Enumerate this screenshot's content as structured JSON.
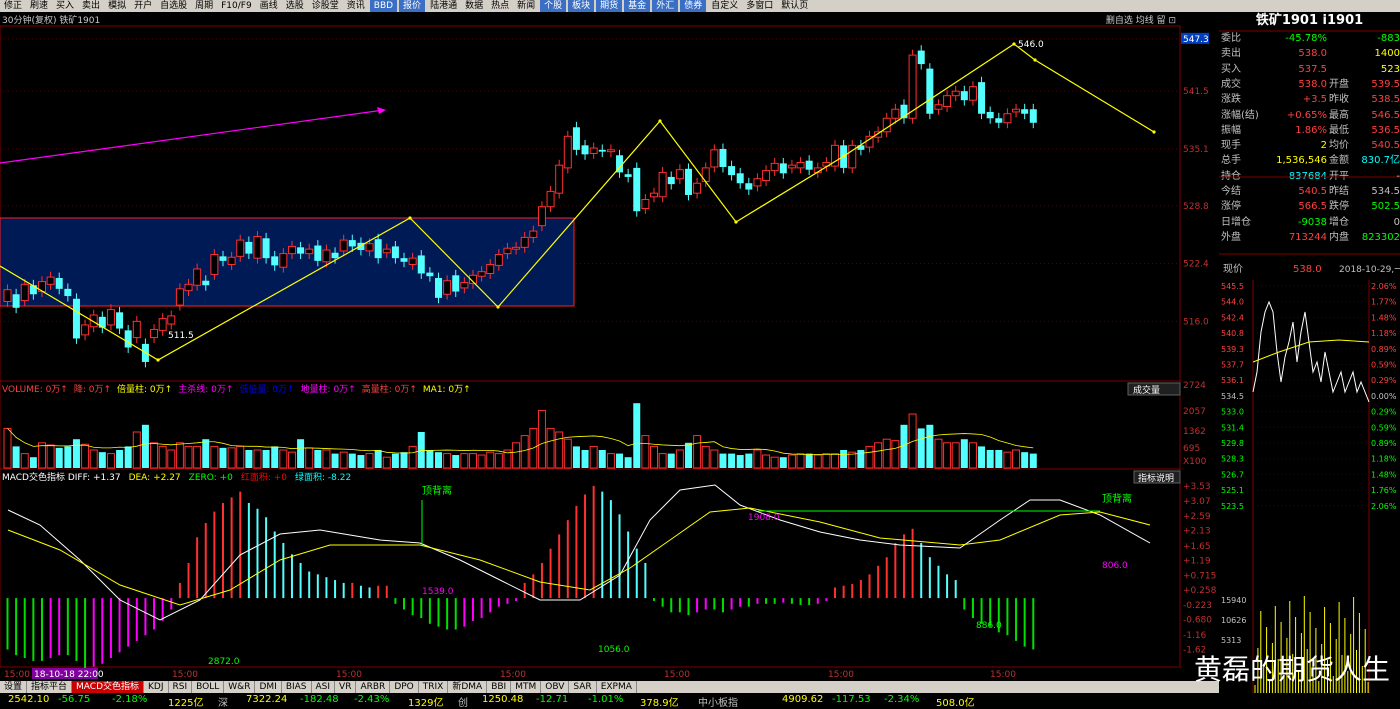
{
  "toolbar": [
    "修正",
    "刷速",
    "买入",
    "卖出",
    "模拟",
    "开户",
    "自选股",
    "周期",
    "F10/F9",
    "画线",
    "选股",
    "诊股堂",
    "资讯",
    "BBD",
    "报价",
    "陆港通",
    "数据",
    "热点",
    "新闻",
    "个股",
    "板块",
    "期货",
    "基金",
    "外汇",
    "债券",
    "自定义",
    "多窗口",
    "默认页"
  ],
  "toolbar_highlight": [
    "BBD",
    "报价",
    "个股",
    "板块",
    "期货",
    "基金",
    "外汇",
    "债券"
  ],
  "chart_title": "30分钟(复权) 铁矿1901",
  "chart_title_right": "删自选 均线 留 ⊡",
  "price_axis": [
    "547.3",
    "541.5",
    "535.1",
    "528.8",
    "522.4",
    "516.0"
  ],
  "annotations": {
    "high": "546.0",
    "low": "511.5"
  },
  "volume_legend": [
    {
      "text": "VOLUME: 0万",
      "color": "#ff4040"
    },
    {
      "text": "降: 0万",
      "color": "#ff4040"
    },
    {
      "text": "倍量柱: 0万",
      "color": "#ffff00"
    },
    {
      "text": "主杀线: 0万",
      "color": "#ff00ff"
    },
    {
      "text": "低倍量: 0万",
      "color": "#0000ff"
    },
    {
      "text": "地量柱: 0万",
      "color": "#ff00ff"
    },
    {
      "text": "高量柱: 0万",
      "color": "#ff4040"
    },
    {
      "text": "MA1: 0万",
      "color": "#ffff00"
    }
  ],
  "volume_button": "成交量",
  "volume_axis": [
    "2724",
    "2057",
    "1362",
    "695",
    "X100"
  ],
  "macd_legend": [
    {
      "text": "MACD交色指标 DIFF: +1.37",
      "color": "#ffffff"
    },
    {
      "text": "DEA: +2.27",
      "color": "#ffff00"
    },
    {
      "text": "ZERO: +0",
      "color": "#00ff00"
    },
    {
      "text": "红面积: +0",
      "color": "#ff0000"
    },
    {
      "text": "绿面积: -8.22",
      "color": "#00ffff"
    }
  ],
  "macd_button": "指标说明",
  "macd_axis": [
    "+3.53",
    "+3.07",
    "+2.59",
    "+2.13",
    "+1.65",
    "+1.19",
    "+0.715",
    "+0.258",
    "-0.223",
    "-0.680",
    "-1.16",
    "-1.62"
  ],
  "macd_labels": {
    "top_div_1": "顶背离",
    "top_div_2": "顶背离",
    "v1539": "1539.0",
    "v2872": "2872.0",
    "v1056": "1056.0",
    "v1908": "1908.0",
    "v886": "886.0",
    "v806": "806.0"
  },
  "time_axis": [
    "15:00",
    "18-10-18 22:00",
    "15:00",
    "15:00",
    "15:00",
    "15:00",
    "15:00",
    "15:00"
  ],
  "quote_panel": {
    "title": "铁矿1901 i1901",
    "rows": [
      {
        "l1": "委比",
        "v1": "-45.78%",
        "c1": "#00ff00",
        "l2": "",
        "v2": "-883",
        "c2": "#00ff00"
      },
      {
        "l1": "卖出",
        "v1": "538.0",
        "c1": "#ff4040",
        "l2": "",
        "v2": "1400",
        "c2": "#ffff00"
      },
      {
        "l1": "买入",
        "v1": "537.5",
        "c1": "#ff4040",
        "l2": "",
        "v2": "523",
        "c2": "#ffff00"
      },
      {
        "l1": "成交",
        "v1": "538.0",
        "c1": "#ff4040",
        "l2": "开盘",
        "v2": "539.5",
        "c2": "#ff4040"
      },
      {
        "l1": "涨跌",
        "v1": "+3.5",
        "c1": "#ff4040",
        "l2": "昨收",
        "v2": "538.5",
        "c2": "#ff4040"
      },
      {
        "l1": "涨幅(结)",
        "v1": "+0.65%",
        "c1": "#ff4040",
        "l2": "最高",
        "v2": "546.5",
        "c2": "#ff4040"
      },
      {
        "l1": "振幅",
        "v1": "1.86%",
        "c1": "#ff4040",
        "l2": "最低",
        "v2": "536.5",
        "c2": "#ff4040"
      },
      {
        "l1": "现手",
        "v1": "2",
        "c1": "#ffff00",
        "l2": "均价",
        "v2": "540.5",
        "c2": "#ff4040"
      },
      {
        "l1": "总手",
        "v1": "1,536,546",
        "c1": "#ffff00",
        "l2": "金额",
        "v2": "830.7亿",
        "c2": "#00ffff"
      },
      {
        "l1": "持仓",
        "v1": "837684",
        "c1": "#00ffff",
        "l2": "开平",
        "v2": "-",
        "c2": "#c0c0c0"
      },
      {
        "l1": "今结",
        "v1": "540.5",
        "c1": "#ff4040",
        "l2": "昨结",
        "v2": "534.5",
        "c2": "#c0c0c0"
      },
      {
        "l1": "涨停",
        "v1": "566.5",
        "c1": "#ff4040",
        "l2": "跌停",
        "v2": "502.5",
        "c2": "#00ff00"
      },
      {
        "l1": "日增仓",
        "v1": "-9038",
        "c1": "#00ff00",
        "l2": "增仓",
        "v2": "0",
        "c2": "#c0c0c0"
      },
      {
        "l1": "外盘",
        "v1": "713244",
        "c1": "#ff4040",
        "l2": "内盘",
        "v2": "823302",
        "c2": "#00ff00"
      }
    ],
    "current_label": "现价",
    "current_price": "538.0",
    "date": "2018-10-29,一",
    "mini_left": [
      "545.5",
      "544.0",
      "542.4",
      "540.8",
      "539.3",
      "537.7",
      "536.1",
      "534.5",
      "533.0",
      "531.4",
      "529.8",
      "528.3",
      "526.7",
      "525.1",
      "523.5",
      "15940",
      "10626",
      "5313"
    ],
    "mini_right": [
      "2.06%",
      "1.77%",
      "1.48%",
      "1.18%",
      "0.89%",
      "0.59%",
      "0.29%",
      "0.00%",
      "0.29%",
      "0.59%",
      "0.89%",
      "1.18%",
      "1.48%",
      "1.76%",
      "2.06%"
    ]
  },
  "tabs": [
    "设置",
    "指标平台",
    "MACD交色指标",
    "KDJ",
    "RSI",
    "BOLL",
    "W&R",
    "DMI",
    "BIAS",
    "ASI",
    "VR",
    "ARBR",
    "DPO",
    "TRIX",
    "新DMA",
    "BBI",
    "MTM",
    "OBV",
    "SAR",
    "EXPMA"
  ],
  "active_tab": "MACD交色指标",
  "status": [
    {
      "text": "2542.10",
      "color": "#ffff00"
    },
    {
      "text": "-56.75",
      "color": "#00ff00"
    },
    {
      "text": "-2.18%",
      "color": "#00ff00"
    },
    {
      "text": "1225亿",
      "color": "#ffff00"
    },
    {
      "text": "深",
      "color": "#c0c0c0"
    },
    {
      "text": "7322.24",
      "color": "#ffff00"
    },
    {
      "text": "-182.48",
      "color": "#00ff00"
    },
    {
      "text": "-2.43%",
      "color": "#00ff00"
    },
    {
      "text": "1329亿",
      "color": "#ffff00"
    },
    {
      "text": "创",
      "color": "#c0c0c0"
    },
    {
      "text": "1250.48",
      "color": "#ffff00"
    },
    {
      "text": "-12.71",
      "color": "#00ff00"
    },
    {
      "text": "-1.01%",
      "color": "#00ff00"
    },
    {
      "text": "378.9亿",
      "color": "#ffff00"
    },
    {
      "text": "中小板指",
      "color": "#c0c0c0"
    },
    {
      "text": "4909.62",
      "color": "#ffff00"
    },
    {
      "text": "-117.53",
      "color": "#00ff00"
    },
    {
      "text": "-2.34%",
      "color": "#00ff00"
    },
    {
      "text": "508.0亿",
      "color": "#ffff00"
    }
  ],
  "watermark": "黄磊的期货人生",
  "chart_data": {
    "type": "candlestick",
    "bars": [
      {
        "o": 518.2,
        "c": 519.5
      },
      {
        "o": 519.0,
        "c": 517.5
      },
      {
        "o": 518.3,
        "c": 520.1
      },
      {
        "o": 520.0,
        "c": 519.0
      },
      {
        "o": 519.3,
        "c": 520.4
      },
      {
        "o": 520.1,
        "c": 520.9
      },
      {
        "o": 520.8,
        "c": 519.6
      },
      {
        "o": 519.6,
        "c": 518.8
      },
      {
        "o": 518.5,
        "c": 514.1
      },
      {
        "o": 514.5,
        "c": 515.6
      },
      {
        "o": 515.4,
        "c": 516.7
      },
      {
        "o": 516.5,
        "c": 515.3
      },
      {
        "o": 515.6,
        "c": 517.3
      },
      {
        "o": 517.0,
        "c": 515.2
      },
      {
        "o": 515.0,
        "c": 513.1
      },
      {
        "o": 514.2,
        "c": 516.0
      },
      {
        "o": 513.5,
        "c": 511.5
      },
      {
        "o": 514.2,
        "c": 515.1
      },
      {
        "o": 515.0,
        "c": 516.3
      },
      {
        "o": 515.7,
        "c": 516.6
      },
      {
        "o": 517.8,
        "c": 519.6
      },
      {
        "o": 519.4,
        "c": 520.1
      },
      {
        "o": 520.0,
        "c": 521.8
      },
      {
        "o": 520.5,
        "c": 520.0
      },
      {
        "o": 521.2,
        "c": 523.4
      },
      {
        "o": 523.2,
        "c": 522.7
      },
      {
        "o": 522.3,
        "c": 523.1
      },
      {
        "o": 523.2,
        "c": 525.0
      },
      {
        "o": 524.8,
        "c": 523.5
      },
      {
        "o": 523.0,
        "c": 525.4
      },
      {
        "o": 525.2,
        "c": 523.0
      },
      {
        "o": 523.2,
        "c": 522.2
      },
      {
        "o": 522.0,
        "c": 523.5
      },
      {
        "o": 523.5,
        "c": 524.3
      },
      {
        "o": 524.2,
        "c": 523.5
      },
      {
        "o": 523.5,
        "c": 524.0
      },
      {
        "o": 524.4,
        "c": 522.7
      },
      {
        "o": 522.6,
        "c": 523.9
      },
      {
        "o": 523.6,
        "c": 523.0
      },
      {
        "o": 523.8,
        "c": 525.0
      },
      {
        "o": 525.0,
        "c": 524.3
      },
      {
        "o": 524.7,
        "c": 523.9
      },
      {
        "o": 523.8,
        "c": 524.6
      },
      {
        "o": 525.1,
        "c": 523.0
      },
      {
        "o": 523.6,
        "c": 524.0
      },
      {
        "o": 524.3,
        "c": 523.0
      },
      {
        "o": 523.0,
        "c": 522.6
      },
      {
        "o": 522.3,
        "c": 523.0
      },
      {
        "o": 523.3,
        "c": 521.3
      },
      {
        "o": 521.4,
        "c": 521.0
      },
      {
        "o": 520.8,
        "c": 518.6
      },
      {
        "o": 519.0,
        "c": 520.5
      },
      {
        "o": 521.1,
        "c": 519.3
      },
      {
        "o": 519.7,
        "c": 520.3
      },
      {
        "o": 520.2,
        "c": 521.1
      },
      {
        "o": 521.0,
        "c": 521.5
      },
      {
        "o": 521.3,
        "c": 522.3
      },
      {
        "o": 522.2,
        "c": 523.4
      },
      {
        "o": 523.5,
        "c": 524.1
      },
      {
        "o": 524.0,
        "c": 524.2
      },
      {
        "o": 524.2,
        "c": 525.3
      },
      {
        "o": 525.3,
        "c": 526.0
      },
      {
        "o": 526.6,
        "c": 528.7
      },
      {
        "o": 528.7,
        "c": 530.4
      },
      {
        "o": 530.2,
        "c": 533.3
      },
      {
        "o": 533.0,
        "c": 536.5
      },
      {
        "o": 537.5,
        "c": 535.0
      },
      {
        "o": 535.5,
        "c": 534.5
      },
      {
        "o": 534.6,
        "c": 535.2
      },
      {
        "o": 535.0,
        "c": 534.8
      },
      {
        "o": 534.8,
        "c": 535.0
      },
      {
        "o": 534.4,
        "c": 532.5
      },
      {
        "o": 532.3,
        "c": 532.0
      },
      {
        "o": 533.0,
        "c": 528.2
      },
      {
        "o": 528.5,
        "c": 529.5
      },
      {
        "o": 529.8,
        "c": 530.2
      },
      {
        "o": 529.8,
        "c": 532.5
      },
      {
        "o": 532.0,
        "c": 531.2
      },
      {
        "o": 531.8,
        "c": 532.8
      },
      {
        "o": 532.9,
        "c": 530.0
      },
      {
        "o": 530.2,
        "c": 531.3
      },
      {
        "o": 531.5,
        "c": 533.0
      },
      {
        "o": 533.1,
        "c": 535.0
      },
      {
        "o": 535.1,
        "c": 533.1
      },
      {
        "o": 533.2,
        "c": 532.2
      },
      {
        "o": 532.4,
        "c": 531.3
      },
      {
        "o": 531.3,
        "c": 530.6
      },
      {
        "o": 531.0,
        "c": 531.8
      },
      {
        "o": 531.6,
        "c": 532.7
      },
      {
        "o": 532.7,
        "c": 533.5
      },
      {
        "o": 533.5,
        "c": 532.4
      },
      {
        "o": 533.0,
        "c": 533.3
      },
      {
        "o": 533.0,
        "c": 533.6
      },
      {
        "o": 533.8,
        "c": 532.8
      },
      {
        "o": 532.5,
        "c": 533.0
      },
      {
        "o": 533.2,
        "c": 533.6
      },
      {
        "o": 533.2,
        "c": 535.5
      },
      {
        "o": 535.5,
        "c": 533.0
      },
      {
        "o": 533.0,
        "c": 535.5
      },
      {
        "o": 535.5,
        "c": 535.0
      },
      {
        "o": 535.3,
        "c": 536.5
      },
      {
        "o": 536.4,
        "c": 537.0
      },
      {
        "o": 537.0,
        "c": 538.5
      },
      {
        "o": 538.5,
        "c": 539.5
      },
      {
        "o": 540.0,
        "c": 538.5
      },
      {
        "o": 538.5,
        "c": 545.5
      },
      {
        "o": 546.0,
        "c": 544.5
      },
      {
        "o": 544.0,
        "c": 539.0
      },
      {
        "o": 539.5,
        "c": 540.0
      },
      {
        "o": 539.8,
        "c": 541.0
      },
      {
        "o": 541.0,
        "c": 541.5
      },
      {
        "o": 541.5,
        "c": 540.5
      },
      {
        "o": 540.5,
        "c": 542.0
      },
      {
        "o": 542.5,
        "c": 539.0
      },
      {
        "o": 539.2,
        "c": 538.5
      },
      {
        "o": 538.5,
        "c": 538.0
      },
      {
        "o": 538.0,
        "c": 539.0
      },
      {
        "o": 539.2,
        "c": 539.5
      },
      {
        "o": 539.5,
        "c": 539.0
      },
      {
        "o": 539.5,
        "c": 538.0
      }
    ],
    "volume": [
      0.55,
      0.3,
      0.2,
      0.15,
      0.35,
      0.32,
      0.28,
      0.3,
      0.4,
      0.33,
      0.25,
      0.22,
      0.2,
      0.25,
      0.3,
      0.5,
      0.6,
      0.35,
      0.3,
      0.25,
      0.35,
      0.3,
      0.3,
      0.4,
      0.3,
      0.28,
      0.28,
      0.3,
      0.25,
      0.25,
      0.25,
      0.3,
      0.25,
      0.22,
      0.4,
      0.28,
      0.25,
      0.25,
      0.2,
      0.22,
      0.2,
      0.18,
      0.2,
      0.25,
      0.15,
      0.2,
      0.22,
      0.3,
      0.5,
      0.25,
      0.22,
      0.2,
      0.18,
      0.2,
      0.2,
      0.18,
      0.22,
      0.2,
      0.25,
      0.35,
      0.45,
      0.55,
      0.8,
      0.55,
      0.5,
      0.4,
      0.3,
      0.25,
      0.3,
      0.25,
      0.2,
      0.2,
      0.15,
      0.9,
      0.45,
      0.3,
      0.2,
      0.2,
      0.25,
      0.35,
      0.45,
      0.3,
      0.25,
      0.2,
      0.2,
      0.18,
      0.2,
      0.25,
      0.18,
      0.15,
      0.15,
      0.18,
      0.2,
      0.2,
      0.18,
      0.2,
      0.2,
      0.25,
      0.22,
      0.25,
      0.3,
      0.35,
      0.4,
      0.38,
      0.6,
      0.75,
      0.55,
      0.6,
      0.4,
      0.35,
      0.35,
      0.4,
      0.35,
      0.3,
      0.25,
      0.25,
      0.22,
      0.25,
      0.22,
      0.2
    ],
    "macd_hist": [
      -0.9,
      -1.0,
      -1.05,
      -1.1,
      -1.1,
      -1.05,
      -1.0,
      -1.0,
      -1.1,
      -1.3,
      -1.2,
      -1.15,
      -1.05,
      -0.95,
      -0.85,
      -0.75,
      -0.65,
      -0.55,
      -0.4,
      -0.2,
      0.1,
      0.45,
      0.9,
      1.15,
      1.35,
      1.5,
      1.6,
      1.7,
      1.5,
      1.4,
      1.25,
      1.0,
      0.8,
      0.6,
      0.45,
      0.3,
      0.25,
      0.2,
      0.15,
      0.1,
      0.1,
      0.05,
      0.02,
      0.05,
      0.05,
      -0.1,
      -0.2,
      -0.3,
      -0.35,
      -0.45,
      -0.5,
      -0.55,
      -0.55,
      -0.5,
      -0.4,
      -0.35,
      -0.25,
      -0.15,
      -0.1,
      -0.05,
      0.1,
      0.25,
      0.45,
      0.7,
      0.95,
      1.2,
      1.45,
      1.65,
      1.8,
      1.7,
      1.55,
      1.3,
      1.0,
      0.7,
      0.45,
      -0.05,
      -0.15,
      -0.25,
      -0.25,
      -0.3,
      -0.25,
      -0.2,
      -0.2,
      -0.25,
      -0.2,
      -0.15,
      -0.15,
      -0.1,
      -0.1,
      -0.1,
      -0.08,
      -0.1,
      -0.12,
      -0.12,
      -0.1,
      -0.05,
      0.02,
      0.05,
      0.08,
      0.15,
      0.25,
      0.4,
      0.55,
      0.8,
      0.95,
      1.05,
      0.8,
      0.55,
      0.4,
      0.25,
      0.15,
      -0.2,
      -0.35,
      -0.45,
      -0.5,
      -0.6,
      -0.65,
      -0.75,
      -0.85,
      -0.9
    ],
    "price_range": [
      509.5,
      548.5
    ],
    "volume_range": [
      0,
      1
    ],
    "macd_range": [
      -1.7,
      3.6
    ]
  }
}
